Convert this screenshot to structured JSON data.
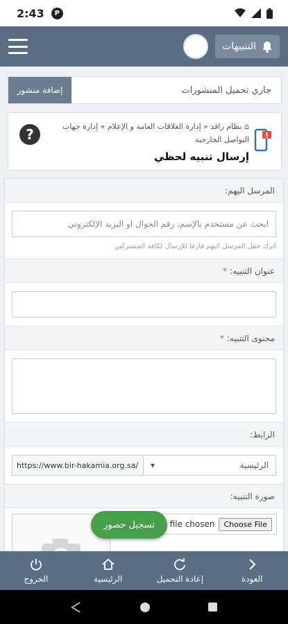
{
  "status_bar": {
    "time": "2:43",
    "badge": "P"
  },
  "topbar": {
    "notifications_label": "التنبيهات"
  },
  "uploading": {
    "text": "جاري تحميل المنشورات",
    "add_post_label": "إضافة منشور"
  },
  "header": {
    "breadcrumb": [
      "نظام رافد",
      "إدارة العلاقات العامة و الإعلام",
      "إدارة جهات التواصل الخارجية"
    ],
    "title": "إرسال تنبيه لحظي"
  },
  "form": {
    "recipients": {
      "label": "المرسل اليهم:",
      "placeholder": "ابحث عن مستخدم بالإسم، رقم الجوال او البريد الإلكتروني",
      "hint": "اترك حقل المرسل اليهم فارغا للإرسال لكافة المشتركين"
    },
    "alert_title": {
      "label": "عنوان التنبيه:",
      "required_mark": "*",
      "value": ""
    },
    "alert_content": {
      "label": "محتوى التنبيه:",
      "required_mark": "*"
    },
    "link": {
      "label": "الرابط:",
      "selected": "الرئيسية",
      "url": "https://www.bir-hakamia.org.sa/"
    },
    "image": {
      "label": "صورة التنبيه:",
      "choose_file": "Choose File",
      "no_file": "No file chosen"
    }
  },
  "attendance_button": "تسجيل حضور",
  "bottom_nav": [
    {
      "label": "العودة",
      "icon": "chevron-right-icon"
    },
    {
      "label": "إعادة التحميل",
      "icon": "reload-icon"
    },
    {
      "label": "الرئيسية",
      "icon": "home-icon"
    },
    {
      "label": "الخروج",
      "icon": "power-icon"
    }
  ],
  "colors": {
    "primary": "#5a6d82",
    "accent_green": "#46a04b",
    "required": "#d9534f"
  }
}
